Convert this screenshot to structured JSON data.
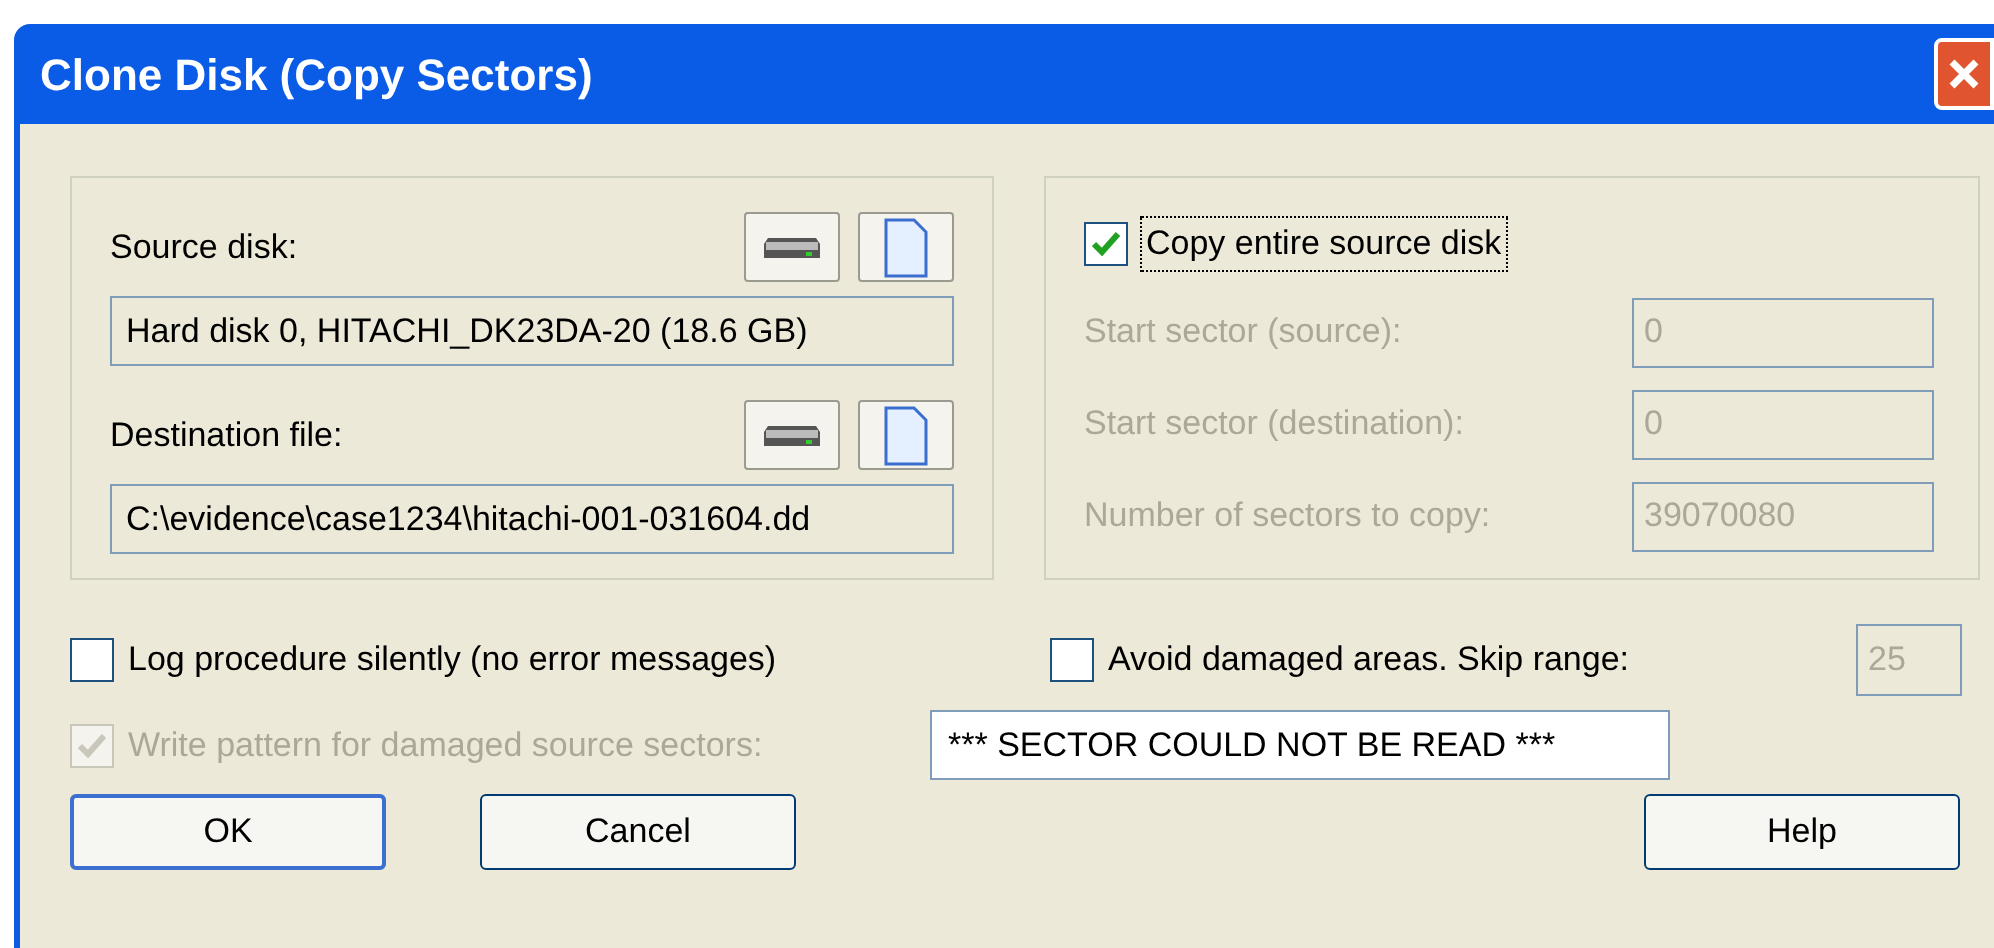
{
  "window": {
    "title": "Clone Disk (Copy Sectors)"
  },
  "disk_fields": [
    {
      "label": "Source disk:",
      "value": "Hard disk 0, HITACHI_DK23DA-20 (18.6 GB)"
    },
    {
      "label": "Destination file:",
      "value": "C:\\evidence\\case1234\\hitachi-001-031604.dd"
    }
  ],
  "copy_entire": {
    "label": "Copy entire source disk",
    "checked": true
  },
  "range_fields": [
    {
      "label": "Start sector (source):",
      "value": "0",
      "disabled": true
    },
    {
      "label": "Start sector (destination):",
      "value": "0",
      "disabled": true
    },
    {
      "label": "Number of sectors to copy:",
      "value": "39070080",
      "disabled": true
    }
  ],
  "log_silently": {
    "label": "Log procedure silently (no error messages)",
    "checked": false,
    "disabled": false
  },
  "avoid_damaged": {
    "label": "Avoid damaged areas. Skip range:",
    "checked": false,
    "disabled": false,
    "skip_range": {
      "value": "25",
      "disabled": true
    }
  },
  "write_pattern": {
    "label": "Write pattern for damaged source sectors:",
    "checked": true,
    "disabled": true,
    "value": "*** SECTOR COULD NOT BE READ ***"
  },
  "buttons": [
    {
      "label": "OK",
      "default": true
    },
    {
      "label": "Cancel",
      "default": false
    },
    {
      "label": "Help",
      "default": false
    }
  ]
}
